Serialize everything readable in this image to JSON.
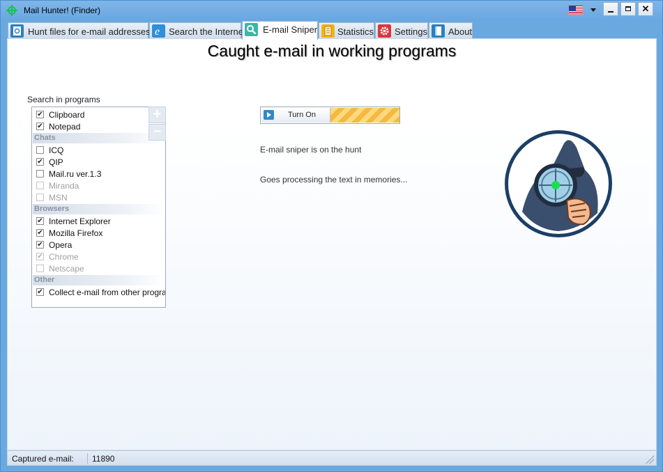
{
  "window": {
    "title": "Mail Hunter! (Finder)",
    "close_glyph": "✕"
  },
  "tabs": [
    {
      "label": "Hunt files for e-mail addresses",
      "icon": "document-icon"
    },
    {
      "label": "Search the Internet",
      "icon": "internet-explorer-icon"
    },
    {
      "label": "E-mail Sniper",
      "icon": "magnifier-icon",
      "active": true
    },
    {
      "label": "Statistics",
      "icon": "statistics-icon"
    },
    {
      "label": "Settings",
      "icon": "gear-icon"
    },
    {
      "label": "About",
      "icon": "book-icon"
    }
  ],
  "main": {
    "title": "Caught e-mail in working programs",
    "search_label": "Search in programs",
    "add_glyph": "+",
    "remove_glyph": "−",
    "toggle_label": "Turn On",
    "status_line1": "E-mail sniper is on the hunt",
    "status_line2": "Goes processing the text in memories..."
  },
  "programs": {
    "top": [
      {
        "label": "Clipboard",
        "checked": true,
        "enabled": true
      },
      {
        "label": "Notepad",
        "checked": true,
        "enabled": true
      }
    ],
    "groups": [
      {
        "name": "Chats",
        "items": [
          {
            "label": "ICQ",
            "checked": false,
            "enabled": true
          },
          {
            "label": "QIP",
            "checked": true,
            "enabled": true
          },
          {
            "label": "Mail.ru ver.1.3",
            "checked": false,
            "enabled": true
          },
          {
            "label": "Miranda",
            "checked": false,
            "enabled": false
          },
          {
            "label": "MSN",
            "checked": false,
            "enabled": false
          }
        ]
      },
      {
        "name": "Browsers",
        "items": [
          {
            "label": "Internet Explorer",
            "checked": true,
            "enabled": true
          },
          {
            "label": "Mozilla Firefox",
            "checked": true,
            "enabled": true
          },
          {
            "label": "Opera",
            "checked": true,
            "enabled": true
          },
          {
            "label": "Chrome",
            "checked": true,
            "enabled": false
          },
          {
            "label": "Netscape",
            "checked": false,
            "enabled": false
          }
        ]
      },
      {
        "name": "Other",
        "items": [
          {
            "label": "Collect e-mail from other programs",
            "checked": true,
            "enabled": true
          }
        ]
      }
    ]
  },
  "statusbar": {
    "label": "Captured e-mail:",
    "value": "11890"
  },
  "colors": {
    "titlebar": "#69a7e2",
    "accent_stripe": "#f6b840"
  }
}
